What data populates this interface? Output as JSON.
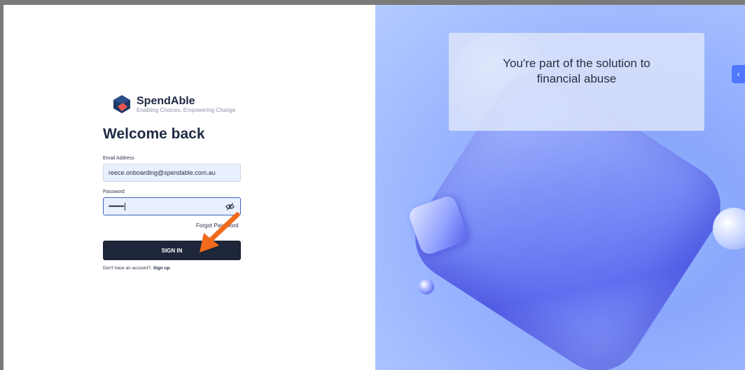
{
  "brand": {
    "name": "SpendAble",
    "tagline": "Enabling Choices, Empowering Change",
    "colors": {
      "dark": "#1e2739",
      "accent": "#e8574f",
      "blue": "#3d63b8"
    }
  },
  "login": {
    "title": "Welcome back",
    "email_label": "Email Address",
    "email_value": "reece.onboarding@spendable.com.au",
    "password_label": "Password",
    "password_value": "••••••••••",
    "forgot_label": "Forgot Password",
    "signin_label": "SIGN IN",
    "signup_prompt": "Don't have an account?.",
    "signup_link": "Sign up"
  },
  "hero": {
    "quote": "You're part of the solution to financial abuse",
    "collapse_icon": "chevron-left-icon"
  },
  "annotation": {
    "arrow_color": "#f26a1b"
  }
}
